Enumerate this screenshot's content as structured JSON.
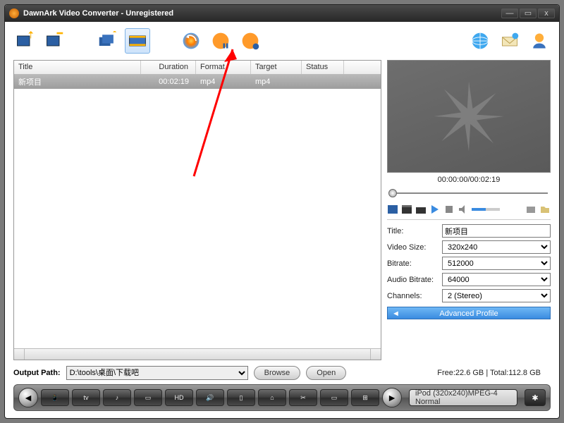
{
  "title": "DawnArk Video Converter - Unregistered",
  "columns": {
    "title": "Title",
    "duration": "Duration",
    "format": "Format",
    "target": "Target",
    "status": "Status"
  },
  "rows": [
    {
      "title": "新项目",
      "duration": "00:02:19",
      "format": "mp4",
      "target": "mp4",
      "status": ""
    }
  ],
  "preview": {
    "time": "00:00:00/00:02:19"
  },
  "props": {
    "title_label": "Title:",
    "title_value": "新项目",
    "vsize_label": "Video Size:",
    "vsize_value": "320x240",
    "bitrate_label": "Bitrate:",
    "bitrate_value": "512000",
    "abitrate_label": "Audio Bitrate:",
    "abitrate_value": "64000",
    "channels_label": "Channels:",
    "channels_value": "2 (Stereo)",
    "advanced": "Advanced Profile"
  },
  "output": {
    "label": "Output Path:",
    "path": "D:\\tools\\桌面\\下载吧",
    "browse": "Browse",
    "open": "Open",
    "disk": "Free:22.6 GB | Total:112.8 GB"
  },
  "formats": [
    "📱",
    "tv",
    "♪",
    "▭",
    "HD",
    "🔊",
    "▯",
    "⌂",
    "✂",
    "▭",
    "⊞"
  ],
  "profile": "iPod (320x240)MPEG-4 Normal"
}
